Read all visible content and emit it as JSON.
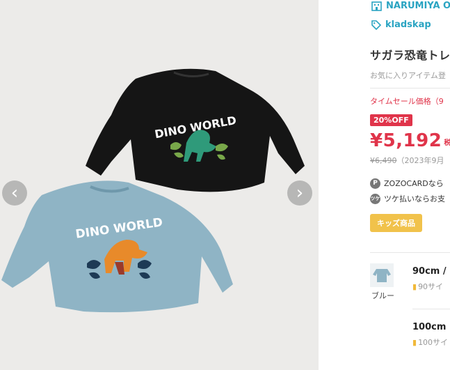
{
  "gallery": {
    "prev_icon": "chevron-left-icon",
    "next_icon": "chevron-right-icon",
    "image_1_text": "DINO WORLD",
    "image_2_text": "DINO WORLD"
  },
  "brand": {
    "name": "NARUMIYA O",
    "icon": "building-icon"
  },
  "shop": {
    "name": "kladskap",
    "icon": "tag-icon"
  },
  "product": {
    "title": "サガラ恐竜トレ",
    "favorite_hint": "お気に入りアイテム登",
    "sale_label": "タイムセール価格（9",
    "discount_badge": "20%OFF",
    "price": "¥5,192",
    "tax_label": "税",
    "original_price": "¥6,490",
    "original_note": "（2023年9月",
    "payment_1": "ZOZOCARDなら",
    "payment_1_icon": "P",
    "payment_2": "ツケ払いならお支",
    "payment_2_icon": "ツケ",
    "category_badge": "キッズ商品"
  },
  "variants": [
    {
      "color": "ブルー",
      "size": "90cm / ",
      "note": "90サイ"
    },
    {
      "color": "",
      "size": "100cm",
      "note": "100サイ"
    }
  ],
  "colors": {
    "accent": "#2aa4c2",
    "sale": "#e0344a",
    "badge": "#f1c24b"
  }
}
